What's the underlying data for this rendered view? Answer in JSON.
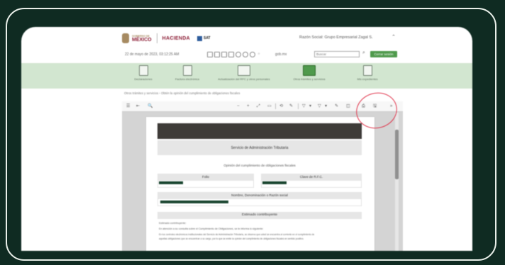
{
  "header": {
    "logo_mexico_top": "GOBIERNO DE",
    "logo_mexico_main": "MÉXICO",
    "logo_hacienda": "HACIENDA",
    "logo_sat": "SAT",
    "user_name": "Razón Social: Grupo Empresarial Zagal S.",
    "user_menu_icon": "chevron-up-icon"
  },
  "subbar": {
    "datetime": "22 de mayo de 2023, 03:12:25 AM",
    "toolbar_icons": [
      "calendar-icon",
      "mail-icon",
      "print-icon",
      "share-icon",
      "accessibility-icon",
      "star-icon",
      "user-icon",
      "favorite-icon"
    ],
    "gob_label": "gob.mx",
    "search_placeholder": "Buscar",
    "close_session": "Cerrar sesión"
  },
  "nav": {
    "items": [
      {
        "label": "Declaraciones",
        "icon": "document-icon",
        "selected": false
      },
      {
        "label": "Factura electrónica",
        "icon": "invoice-icon",
        "selected": false
      },
      {
        "label": "Actualización del RFC y otros personales",
        "icon": "monitor-icon",
        "selected": false
      },
      {
        "label": "Otros trámites y servicios",
        "icon": "computer-icon",
        "selected": true
      },
      {
        "label": "Mis expedientes",
        "icon": "folder-icon",
        "selected": false
      }
    ]
  },
  "breadcrumb": "Otros trámites y servicios  ›  Obtén la opinión del cumplimiento de obligaciones fiscales",
  "pdf_viewer": {
    "toolbar_left": [
      "☰",
      "⇤",
      "🔍"
    ],
    "toolbar_middle": [
      "−",
      "+",
      "⤢",
      "▭",
      "⟲",
      "✎",
      "▽",
      "▾",
      "▽",
      "▾",
      "✎"
    ],
    "toolbar_right": [
      "◫",
      "⎙",
      "🖫",
      "»"
    ],
    "page": {
      "sat_title": "Servicio de Administración Tributaria",
      "opinion_title": "Opinión del cumplimiento de obligaciones fiscales",
      "folio_label": "Folio",
      "rfc_label": "Clave de R.F.C.",
      "name_label": "Nombre, Denominación o Razón social",
      "estado_label": "Estimado contribuyente",
      "line1": "Estimado contribuyente:",
      "line2": "En atención a su consulta sobre el Cumplimiento de Obligaciones, se le informa lo siguiente:",
      "line3": "En los controles electrónicos institucionales del Servicio de Administración Tributaria, se observa que usted se encuentra al corriente en el cumplimiento de",
      "line4": "aquellas obligaciones que se encuentran a su cargo, por lo que se emite la opinión del cumplimiento de obligaciones fiscales en sentido positivo."
    }
  },
  "colors": {
    "background": "#0f2b22",
    "nav_bg": "#d2e6d0",
    "accent_green": "#4f9a4c",
    "brand_red": "#8c1d35",
    "annotation_circle": "#e0334a",
    "redaction": "#19452f"
  }
}
